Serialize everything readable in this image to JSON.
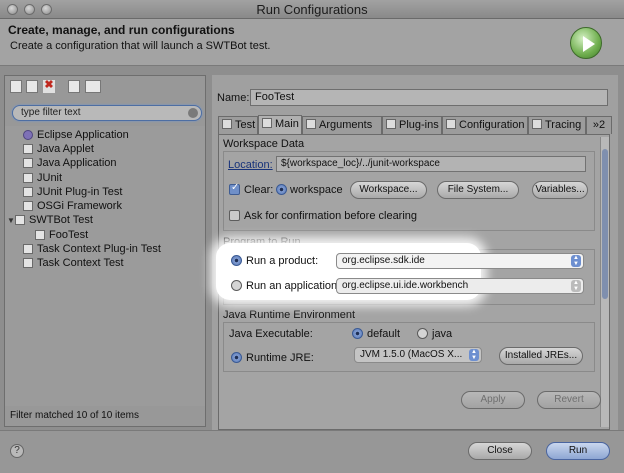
{
  "window": {
    "title": "Run Configurations"
  },
  "header": {
    "title": "Create, manage, and run configurations",
    "description": "Create a configuration that will launch a SWTBot test."
  },
  "left_panel": {
    "filter_placeholder": "type filter text",
    "tree": [
      {
        "label": "Eclipse Application",
        "icon": "eclipse-icon"
      },
      {
        "label": "Java Applet",
        "icon": "applet-icon"
      },
      {
        "label": "Java Application",
        "icon": "java-app-icon"
      },
      {
        "label": "JUnit",
        "icon": "junit-icon"
      },
      {
        "label": "JUnit Plug-in Test",
        "icon": "junit-plugin-icon"
      },
      {
        "label": "OSGi Framework",
        "icon": "osgi-icon"
      },
      {
        "label": "SWTBot Test",
        "icon": "swtbot-icon",
        "expanded": true
      },
      {
        "label": "FooTest",
        "icon": "config-icon",
        "selected": true
      },
      {
        "label": "Task Context Plug-in Test",
        "icon": "task-context-plugin-icon"
      },
      {
        "label": "Task Context Test",
        "icon": "task-context-icon"
      }
    ],
    "status": "Filter matched 10 of 10 items"
  },
  "config": {
    "name_label": "Name:",
    "name_value": "FooTest",
    "tabs": [
      "Test",
      "Main",
      "Arguments",
      "Plug-ins",
      "Configuration",
      "Tracing"
    ],
    "tabs_overflow": "»2",
    "selected_tab": "Main",
    "workspace_data": {
      "title": "Workspace Data",
      "location_label": "Location:",
      "location_value": "${workspace_loc}/../junit-workspace",
      "clear_label": "Clear:",
      "clear_checked": true,
      "workspace_radio": "workspace",
      "btn_workspace": "Workspace...",
      "btn_filesystem": "File System...",
      "btn_variables": "Variables...",
      "ask_confirm": "Ask for confirmation before clearing",
      "ask_confirm_checked": false
    },
    "program": {
      "title": "Program to Run",
      "run_product_label": "Run a product:",
      "run_product_value": "org.eclipse.sdk.ide",
      "run_app_label": "Run an application:",
      "run_app_value": "org.eclipse.ui.ide.workbench",
      "selected": "product"
    },
    "jre": {
      "title": "Java Runtime Environment",
      "executable_label": "Java Executable:",
      "opt_default": "default",
      "opt_java": "java",
      "runtime_label": "Runtime JRE:",
      "runtime_value": "JVM 1.5.0 (MacOS X...",
      "btn_installed": "Installed JREs..."
    },
    "apply": "Apply",
    "revert": "Revert"
  },
  "footer": {
    "help": "?",
    "close": "Close",
    "run": "Run"
  }
}
